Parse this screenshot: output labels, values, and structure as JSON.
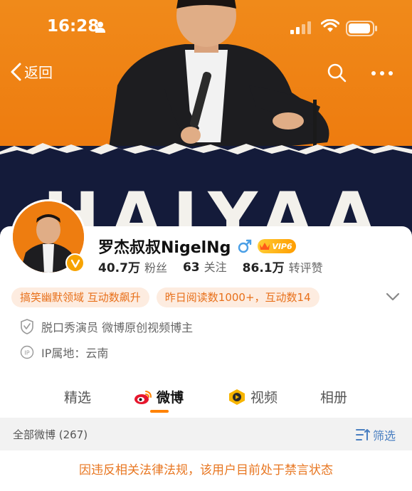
{
  "status_bar": {
    "time": "16:28"
  },
  "nav": {
    "back_label": "返回"
  },
  "cover": {
    "banner_text": "HAIYAA"
  },
  "profile": {
    "name": "罗杰叔叔NigelNg",
    "vip_label": "VIP6",
    "stats": [
      {
        "value": "40.7万",
        "label": "粉丝"
      },
      {
        "value": "63",
        "label": "关注"
      },
      {
        "value": "86.1万",
        "label": "转评赞"
      }
    ],
    "tags": [
      "搞笑幽默领域 互动数飙升",
      "昨日阅读数1000+，互动数14"
    ],
    "verification": "脱口秀演员 微博原创视频博主",
    "ip_location": "IP属地：云南"
  },
  "tabs": [
    {
      "label": "精选"
    },
    {
      "label": "微博"
    },
    {
      "label": "视频"
    },
    {
      "label": "相册"
    }
  ],
  "feed": {
    "count_label": "全部微博 (267)",
    "filter_label": "筛选",
    "notice": "因违反相关法律法规，该用户目前处于禁言状态"
  },
  "colors": {
    "accent": "#ff8200",
    "cover_orange": "#ee7d10",
    "cover_navy": "#141b3a",
    "tag_text": "#e8701a",
    "link_blue": "#4a7fc1"
  }
}
